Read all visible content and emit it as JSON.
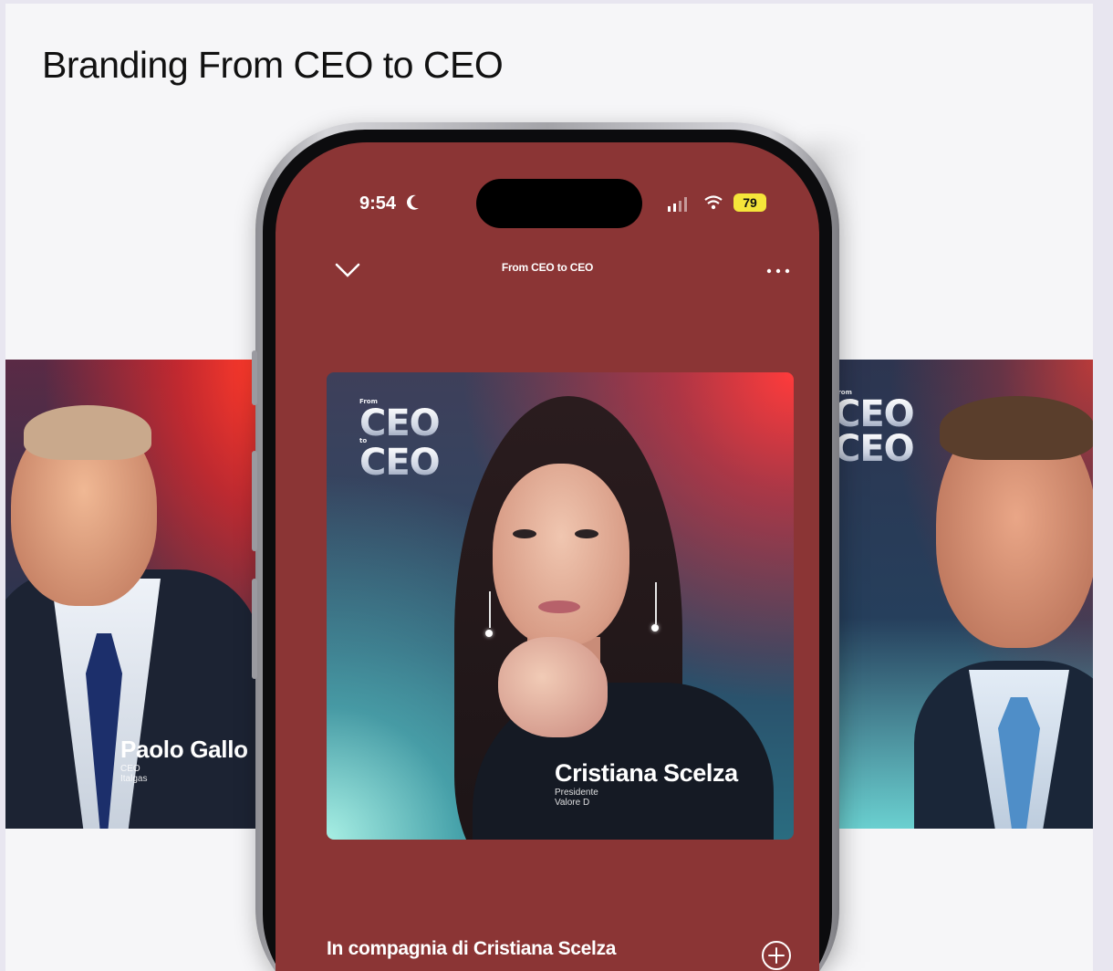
{
  "page": {
    "title": "Branding From CEO to CEO"
  },
  "phone": {
    "status": {
      "time": "9:54",
      "battery": "79"
    },
    "header": {
      "title": "From CEO to CEO"
    },
    "cover": {
      "logo_top": "From",
      "logo_mid": "to",
      "logo_word": "CEO",
      "name": "Cristiana Scelza",
      "role": "Presidente",
      "org": "Valore D"
    },
    "episode_title": "In compagnia di Cristiana Scelza"
  },
  "left_panel": {
    "name": "Paolo Gallo",
    "role": "CEO",
    "org": "Italgas"
  },
  "right_panel": {
    "logo_top": "From",
    "logo_word": "CEO"
  },
  "colors": {
    "screen_bg": "#8b3535",
    "battery_badge": "#f5e53a",
    "page_bg": "#f6f6f8"
  },
  "icons": [
    "moon-icon",
    "signal-icon",
    "wifi-icon",
    "chevron-down-icon",
    "more-icon",
    "add-icon"
  ]
}
